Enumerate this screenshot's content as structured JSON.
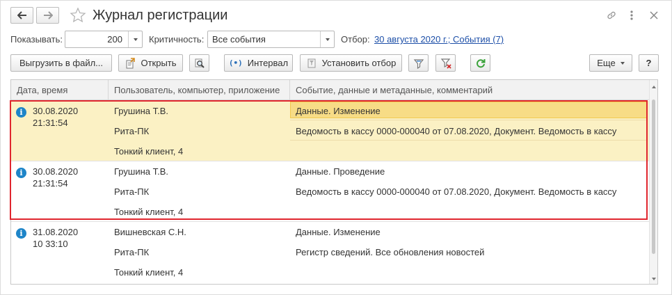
{
  "window": {
    "title": "Журнал регистрации"
  },
  "filters": {
    "show_label": "Показывать:",
    "show_value": "200",
    "criticality_label": "Критичность:",
    "criticality_value": "Все события",
    "selection_label": "Отбор:",
    "selection_link": "30 августа 2020 г.; События (7)"
  },
  "toolbar": {
    "export_label": "Выгрузить в файл...",
    "open_label": "Открыть",
    "interval_label": "Интервал",
    "set_filter_label": "Установить отбор",
    "more_label": "Еще",
    "help_label": "?"
  },
  "table": {
    "columns": [
      "Дата, время",
      "Пользователь, компьютер, приложение",
      "Событие, данные и метаданные, комментарий"
    ],
    "rows": [
      {
        "date": "30.08.2020",
        "time": "21:31:54",
        "user": "Грушина Т.В.",
        "computer": "Рита-ПК",
        "app": "Тонкий клиент, 4",
        "event": "Данные. Изменение",
        "data": "Ведомость в кассу 0000-000040 от 07.08.2020, Документ. Ведомость в кассу",
        "comment": ""
      },
      {
        "date": "30.08.2020",
        "time": "21:31:54",
        "user": "Грушина Т.В.",
        "computer": "Рита-ПК",
        "app": "Тонкий клиент, 4",
        "event": "Данные. Проведение",
        "data": "Ведомость в кассу 0000-000040 от 07.08.2020, Документ. Ведомость в кассу",
        "comment": ""
      },
      {
        "date": "31.08.2020",
        "time": "10 33:10",
        "user": "Вишневская С.Н.",
        "computer": "Рита-ПК",
        "app": "Тонкий клиент, 4",
        "event": "Данные. Изменение",
        "data": "Регистр сведений. Все обновления новостей",
        "comment": ""
      }
    ]
  },
  "colors": {
    "selected_row": "#fbf1c4",
    "current_cell": "#f7dc86",
    "highlight_border": "#e0262e",
    "link": "#1d4fa8",
    "info_icon": "#1e85c8",
    "refresh_icon": "#3aa23a"
  }
}
